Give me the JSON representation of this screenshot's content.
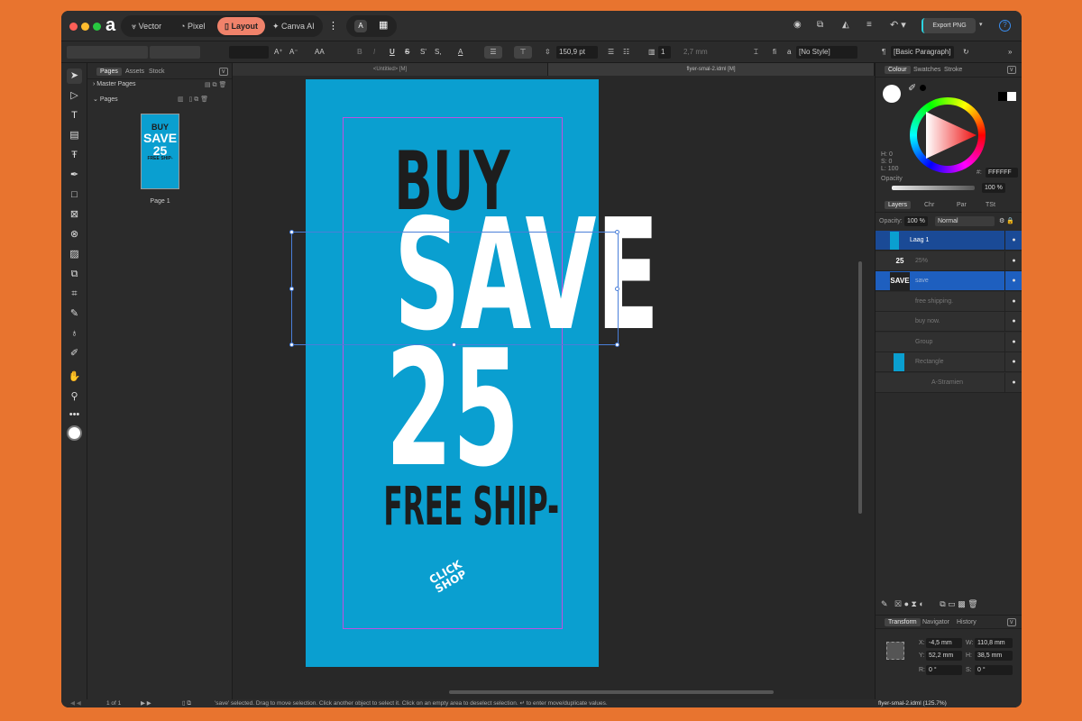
{
  "titlebar": {
    "personas": [
      "Vector",
      "Pixel",
      "Layout",
      "Canva AI"
    ],
    "active_persona": "Layout",
    "export_label": "Export PNG"
  },
  "toolbar": {
    "leading": "150,9 pt",
    "columns": "1",
    "gutter": "2,7 mm",
    "char_style": "[No Style]",
    "para_style": "[Basic Paragraph]",
    "aa": "AA",
    "b": "B",
    "i": "I",
    "u": "U",
    "s": "S"
  },
  "doc_tabs": [
    "<Untitled> [M]",
    "flyer-smal-2.idml [M]"
  ],
  "pages_panel": {
    "tabs": [
      "Pages",
      "Assets",
      "Stock"
    ],
    "master_pages": "Master Pages",
    "pages": "Pages",
    "page_label": "Page 1"
  },
  "poster": {
    "bg": "#0a9fd0",
    "line1": "BUY",
    "line2": "SAVE",
    "line3": "25",
    "line4": "FREE SHIP-",
    "logo": "CLICK SHOP"
  },
  "colour_panel": {
    "tabs": [
      "Colour",
      "Swatches",
      "Stroke"
    ],
    "h": "H: 0",
    "s": "S: 0",
    "l": "L: 100",
    "hex_label": "#:",
    "hex": "FFFFFF",
    "opacity_label": "Opacity",
    "opacity": "100 %"
  },
  "layers_panel": {
    "tabs": [
      "Layers",
      "Chr",
      "Par",
      "TSt"
    ],
    "opacity_label": "Opacity:",
    "opacity": "100 %",
    "blend": "Normal",
    "layers": [
      {
        "name": "Laag 1",
        "thumb": "",
        "selected": false
      },
      {
        "name": "25%",
        "thumb": "25",
        "selected": false
      },
      {
        "name": "save",
        "thumb": "SAVE",
        "selected": true
      },
      {
        "name": "free shipping.",
        "thumb": "",
        "selected": false
      },
      {
        "name": "buy now.",
        "thumb": "",
        "selected": false
      },
      {
        "name": "Group",
        "thumb": "",
        "selected": false
      },
      {
        "name": "Rectangle",
        "thumb": "",
        "selected": false
      },
      {
        "name": "A-Stramien",
        "thumb": "",
        "selected": false
      }
    ]
  },
  "transform_panel": {
    "tabs": [
      "Transform",
      "Navigator",
      "History"
    ],
    "x_label": "X:",
    "x": "-4,5 mm",
    "y_label": "Y:",
    "y": "52,2 mm",
    "w_label": "W:",
    "w": "110,8 mm",
    "h_label": "H:",
    "h": "38,5 mm",
    "r_label": "R:",
    "r": "0 °",
    "s_label": "S:",
    "s": "0 °"
  },
  "status": {
    "page": "1 of 1",
    "message": "'save' selected. Drag to move selection. Click another object to select it. Click on an empty area to deselect selection. ↵ to enter move/duplicate values.",
    "file": "flyer-smal-2.idml (125.7%)"
  }
}
